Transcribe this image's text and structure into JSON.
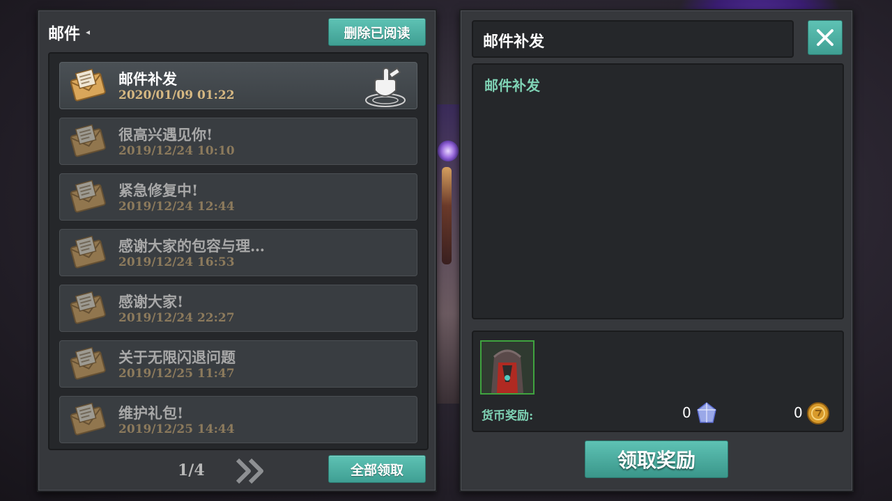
{
  "mailbox": {
    "title": "邮件",
    "delete_read_label": "删除已阅读",
    "claim_all_label": "全部领取",
    "page_indicator": "1/4",
    "items": [
      {
        "subject": "邮件补发",
        "date": "2020/01/09  01:22",
        "selected": true
      },
      {
        "subject": "很高兴遇见你!",
        "date": "2019/12/24  10:10",
        "selected": false
      },
      {
        "subject": "紧急修复中!",
        "date": "2019/12/24  12:44",
        "selected": false
      },
      {
        "subject": "感谢大家的包容与理…",
        "date": "2019/12/24  16:53",
        "selected": false
      },
      {
        "subject": "感谢大家!",
        "date": "2019/12/24  22:27",
        "selected": false
      },
      {
        "subject": "关于无限闪退问题",
        "date": "2019/12/25  11:47",
        "selected": false
      },
      {
        "subject": "维护礼包!",
        "date": "2019/12/25  14:44",
        "selected": false
      }
    ]
  },
  "detail": {
    "title": "邮件补发",
    "content": "邮件补发",
    "currency_label": "货币奖励:",
    "crystal_amount": "0",
    "coin_amount": "0",
    "claim_label": "领取奖励"
  },
  "icons": {
    "envelope": "envelope-icon",
    "hand": "pointer-hand-icon",
    "next": "double-chevron-right-icon",
    "close": "close-icon",
    "crystal": "crystal-icon",
    "coin": "coin-icon"
  },
  "colors": {
    "accent": "#4fb0a4",
    "highlight_text": "#7fd3b5",
    "date_text": "#d6b882"
  }
}
